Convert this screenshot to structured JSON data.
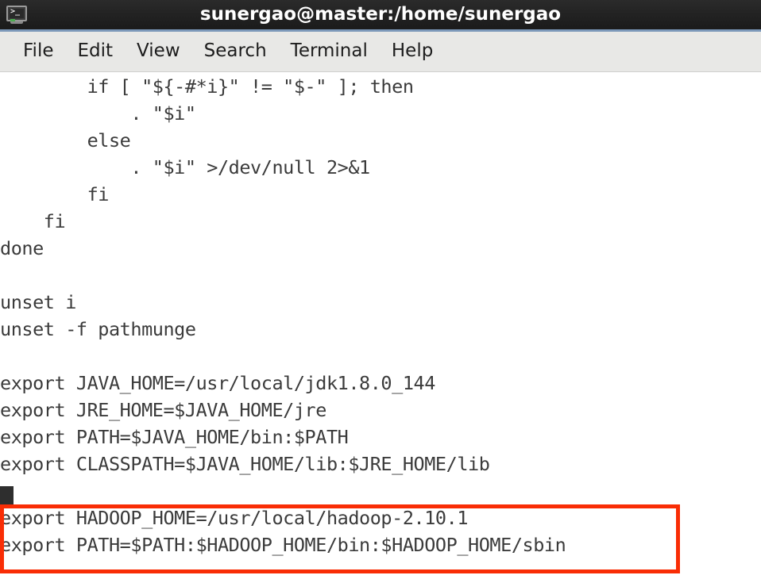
{
  "window": {
    "title": "sunergao@master:/home/sunergao",
    "icon": "terminal-icon"
  },
  "menubar": {
    "items": [
      {
        "label": "File"
      },
      {
        "label": "Edit"
      },
      {
        "label": "View"
      },
      {
        "label": "Search"
      },
      {
        "label": "Terminal"
      },
      {
        "label": "Help"
      }
    ]
  },
  "terminal": {
    "lines": [
      "        if [ \"${-#*i}\" != \"$-\" ]; then",
      "            . \"$i\"",
      "        else",
      "            . \"$i\" >/dev/null 2>&1",
      "        fi",
      "    fi",
      "done",
      "",
      "unset i",
      "unset -f pathmunge",
      "",
      "export JAVA_HOME=/usr/local/jdk1.8.0_144",
      "export JRE_HOME=$JAVA_HOME/jre",
      "export PATH=$JAVA_HOME/bin:$PATH",
      "export CLASSPATH=$JAVA_HOME/lib:$JRE_HOME/lib",
      "",
      "export HADOOP_HOME=/usr/local/hadoop-2.10.1",
      "export PATH=$PATH:$HADOOP_HOME/bin:$HADOOP_HOME/sbin"
    ],
    "cursor": {
      "visible": true,
      "row": 15,
      "col": 0
    },
    "annotation": {
      "type": "rectangle",
      "color": "#f92d05",
      "covers_lines": [
        16,
        17
      ]
    },
    "colors": {
      "background": "#ffffff",
      "foreground": "#3b3b3b",
      "titlebar_background": "#232323",
      "titlebar_accent": "#7d99ba",
      "menubar_background": "#e8e8e6",
      "annotation": "#f92d05"
    }
  }
}
